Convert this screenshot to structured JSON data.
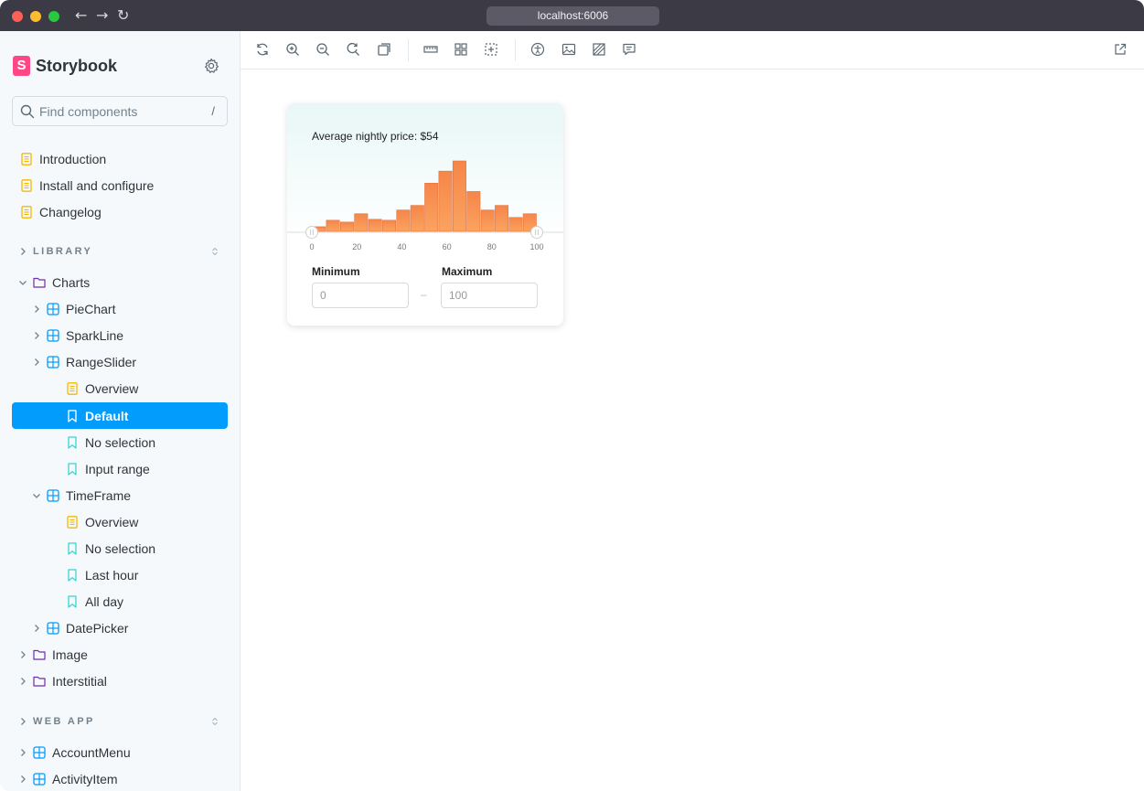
{
  "browser": {
    "url": "localhost:6006"
  },
  "brand": {
    "name": "Storybook",
    "logo_letter": "S"
  },
  "search": {
    "placeholder": "Find components",
    "shortcut": "/"
  },
  "docs": [
    "Introduction",
    "Install and configure",
    "Changelog"
  ],
  "sections": {
    "library": "LIBRARY",
    "webapp": "WEB APP"
  },
  "tree": {
    "charts": "Charts",
    "piechart": "PieChart",
    "sparkline": "SparkLine",
    "rangeslider": "RangeSlider",
    "rs_overview": "Overview",
    "rs_default": "Default",
    "rs_noselection": "No selection",
    "rs_inputrange": "Input range",
    "timeframe": "TimeFrame",
    "tf_overview": "Overview",
    "tf_noselection": "No selection",
    "tf_lasthour": "Last hour",
    "tf_allday": "All day",
    "datepicker": "DatePicker",
    "image": "Image",
    "interstitial": "Interstitial",
    "accountmenu": "AccountMenu",
    "activityitem": "ActivityItem"
  },
  "toolbar_icons": [
    "reload-icon",
    "zoom-in-icon",
    "zoom-out-icon",
    "zoom-reset-icon",
    "background-icon",
    "measure-icon",
    "grid-icon",
    "outline-icon",
    "accessibility-icon",
    "image-icon",
    "vision-icon",
    "comment-icon",
    "open-new-tab-icon"
  ],
  "card": {
    "title": "Average nightly price: $54",
    "min_label": "Minimum",
    "max_label": "Maximum",
    "min_value": "0",
    "max_value": "100",
    "separator": "–"
  },
  "chart_data": {
    "type": "bar",
    "xlim": [
      0,
      100
    ],
    "x_ticks": [
      "0",
      "20",
      "40",
      "60",
      "80",
      "100"
    ],
    "bins": 16,
    "values": [
      5,
      12,
      10,
      19,
      13,
      12,
      23,
      28,
      52,
      65,
      76,
      43,
      23,
      28,
      15,
      19
    ],
    "selection": [
      0,
      100
    ],
    "bar_color": "#f5864a"
  },
  "colors": {
    "accent": "#029cfd",
    "brand": "#ff4785",
    "doc": "#f5b800",
    "story": "#37d5d3",
    "folder": "#6f2cac",
    "component": "#029cfd"
  }
}
